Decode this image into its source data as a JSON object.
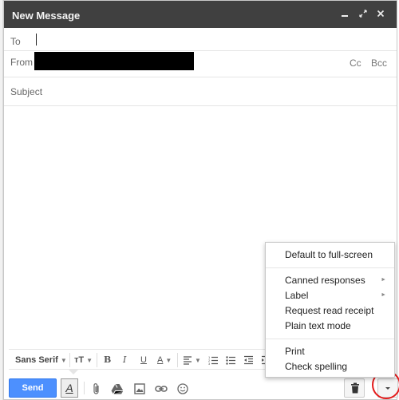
{
  "window": {
    "title": "New Message",
    "controls": {
      "minimize": "_",
      "expand": "⤢",
      "close": "✕"
    }
  },
  "fields": {
    "to_label": "To",
    "from_label": "From",
    "cc_label": "Cc",
    "bcc_label": "Bcc",
    "subject_placeholder": "Subject"
  },
  "format_toolbar": {
    "font": "Sans Serif",
    "size_icon": "тT",
    "bold": "B",
    "italic": "I",
    "underline": "U",
    "text_color": "A",
    "align_icon": "align-icon",
    "numbered_list_icon": "numbered-list-icon",
    "bulleted_list_icon": "bulleted-list-icon",
    "indent_less_icon": "indent-less-icon",
    "indent_more_icon": "indent-more-icon"
  },
  "bottom_bar": {
    "send_label": "Send",
    "format_toggle": "A",
    "icons": [
      "paperclip-icon",
      "drive-icon",
      "photo-icon",
      "link-icon",
      "emoji-icon",
      "trash-icon",
      "more-options-icon"
    ]
  },
  "menu": {
    "items": [
      {
        "label": "Default to full-screen"
      },
      {
        "label": "Canned responses",
        "submenu": true
      },
      {
        "label": "Label",
        "submenu": true
      },
      {
        "label": "Request read receipt"
      },
      {
        "label": "Plain text mode"
      },
      {
        "label": "Print"
      },
      {
        "label": "Check spelling"
      }
    ]
  },
  "colors": {
    "titlebar": "#404040",
    "send_button": "#4d90fe",
    "highlight_circle": "#e41b1b"
  }
}
